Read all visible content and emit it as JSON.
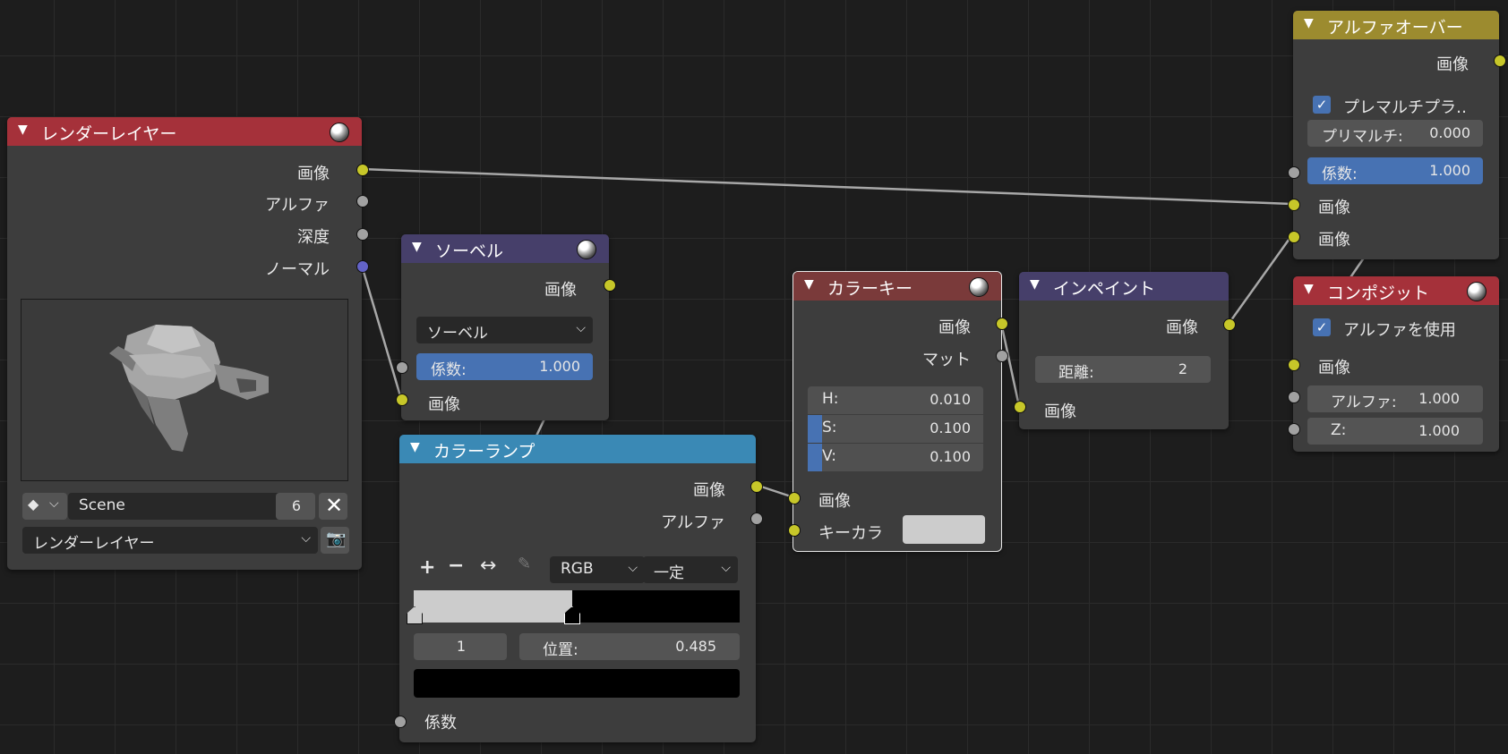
{
  "nodes": {
    "render_layers": {
      "title": "レンダーレイヤー",
      "outputs": [
        "画像",
        "アルファ",
        "深度",
        "ノーマル"
      ],
      "scene": "Scene",
      "scene_users": "6",
      "layer": "レンダーレイヤー",
      "header_color": "#a5313a"
    },
    "sobel": {
      "title": "ソーベル",
      "output": "画像",
      "filter_type": "ソーベル",
      "fac_label": "係数:",
      "fac_value": "1.000",
      "input": "画像",
      "header_color": "#463f6a"
    },
    "color_ramp": {
      "title": "カラーランプ",
      "outputs": [
        "画像",
        "アルファ"
      ],
      "color_mode": "RGB",
      "interpolation": "一定",
      "stop_index": "1",
      "pos_label": "位置:",
      "pos_value": "0.485",
      "input": "係数",
      "header_color": "#3a89b5",
      "ramp_stop_fraction": 0.485
    },
    "color_key": {
      "title": "カラーキー",
      "outputs": [
        "画像",
        "マット"
      ],
      "h_label": "H:",
      "h_value": "0.010",
      "s_label": "S:",
      "s_value": "0.100",
      "v_label": "V:",
      "v_value": "0.100",
      "inputs": [
        "画像",
        "キーカラ"
      ],
      "key_color": "#cccccc",
      "header_color": "#7a3a3a"
    },
    "inpaint": {
      "title": "インペイント",
      "output": "画像",
      "dist_label": "距離:",
      "dist_value": "2",
      "input": "画像",
      "header_color": "#463f6a"
    },
    "alpha_over": {
      "title": "アルファオーバー",
      "output": "画像",
      "premul_label": "プレマルチプラ‥",
      "premul_checked": true,
      "premul_factor_label": "プリマルチ:",
      "premul_factor_value": "0.000",
      "fac_label": "係数:",
      "fac_value": "1.000",
      "inputs": [
        "画像",
        "画像"
      ],
      "header_color": "#9c8b2f"
    },
    "composite": {
      "title": "コンポジット",
      "use_alpha_label": "アルファを使用",
      "use_alpha_checked": true,
      "input": "画像",
      "alpha_label": "アルファ:",
      "alpha_value": "1.000",
      "z_label": "Z:",
      "z_value": "1.000",
      "header_color": "#a5313a"
    }
  }
}
